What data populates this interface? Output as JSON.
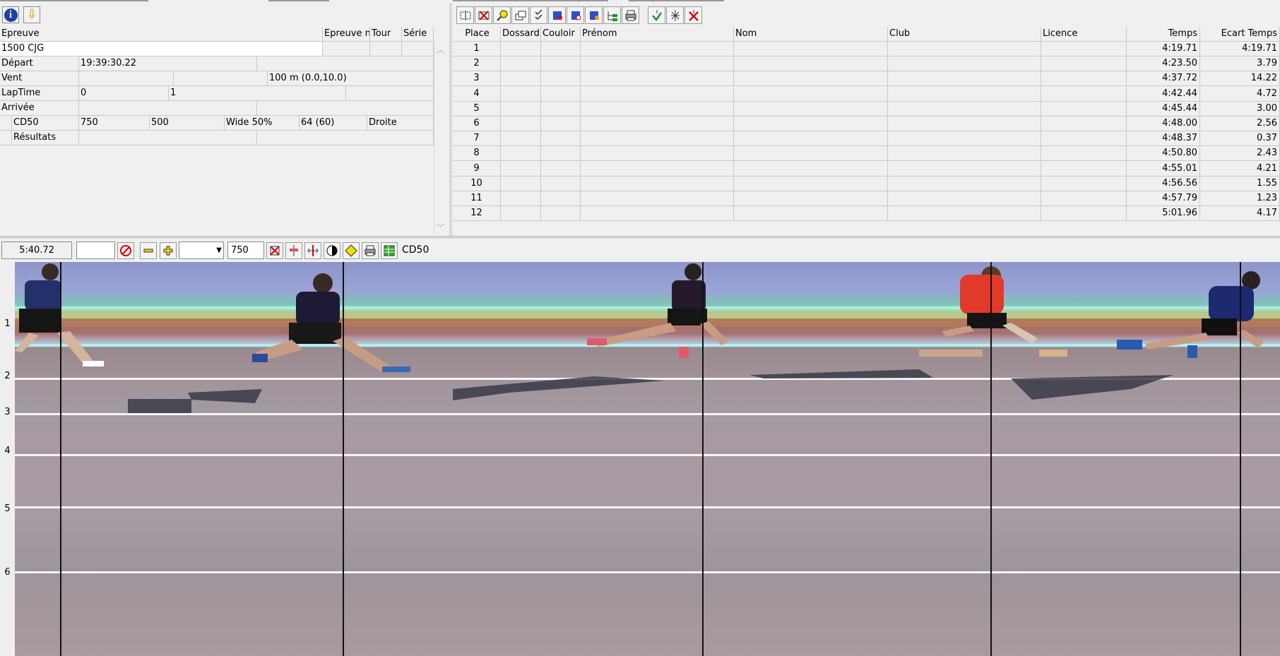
{
  "left": {
    "headers": {
      "epreuve": "Epreuve",
      "epreuve_n": "Epreuve n",
      "tour": "Tour",
      "serie": "Série"
    },
    "event_name": "1500 CJG",
    "rows": {
      "depart_label": "Départ",
      "depart_value": "19:39:30.22",
      "vent_label": "Vent",
      "vent_value": "100 m (0.0,10.0)",
      "laptime_label": "LapTime",
      "laptime_v1": "0",
      "laptime_v2": "1",
      "arrivee_label": "Arrivée",
      "cd50_label": "CD50",
      "cd50_v1": "750",
      "cd50_v2": "500",
      "cd50_v3": "Wide 50%",
      "cd50_v4": "64  (60)",
      "cd50_v5": "Droite",
      "resultats_label": "Résultats"
    }
  },
  "results": {
    "columns": [
      "Place",
      "Dossard",
      "Couloir",
      "Prénom",
      "Nom",
      "Club",
      "Licence",
      "Temps",
      "Ecart Temps"
    ],
    "rows": [
      {
        "place": "1",
        "temps": "4:19.71",
        "ecart": "4:19.71"
      },
      {
        "place": "2",
        "temps": "4:23.50",
        "ecart": "3.79"
      },
      {
        "place": "3",
        "temps": "4:37.72",
        "ecart": "14.22"
      },
      {
        "place": "4",
        "temps": "4:42.44",
        "ecart": "4.72"
      },
      {
        "place": "5",
        "temps": "4:45.44",
        "ecart": "3.00"
      },
      {
        "place": "6",
        "temps": "4:48.00",
        "ecart": "2.56"
      },
      {
        "place": "7",
        "temps": "4:48.37",
        "ecart": "0.37"
      },
      {
        "place": "8",
        "temps": "4:50.80",
        "ecart": "2.43"
      },
      {
        "place": "9",
        "temps": "4:55.01",
        "ecart": "4.21"
      },
      {
        "place": "10",
        "temps": "4:56.56",
        "ecart": "1.55"
      },
      {
        "place": "11",
        "temps": "4:57.79",
        "ecart": "1.23"
      },
      {
        "place": "12",
        "temps": "5:01.96",
        "ecart": "4.17"
      }
    ]
  },
  "bottom_toolbar": {
    "time": "5:40.72",
    "field_empty": "",
    "zoom_value": "750",
    "camera_label": "CD50"
  },
  "lanes": [
    "1",
    "2",
    "3",
    "4",
    "5",
    "6"
  ]
}
